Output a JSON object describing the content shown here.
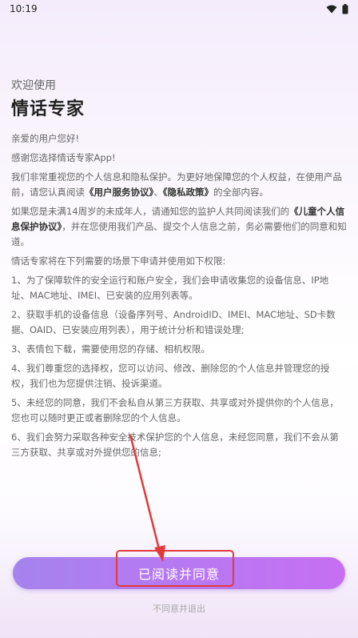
{
  "status_bar": {
    "time": "10:19"
  },
  "header": {
    "welcome": "欢迎使用",
    "title": "情话专家"
  },
  "content": {
    "greeting": "亲爱的用户您好!",
    "thanks": "感谢您选择情话专家App!",
    "p1_a": "我们非常重视您的个人信息和隐私保护。为更好地保障您的个人权益，在使用产品前，请您认真阅读",
    "p1_link1": "《用户服务协议》",
    "p1_b": "、",
    "p1_link2": "《隐私政策》",
    "p1_c": "的全部内容。",
    "p2_a": "如果您是未满14周岁的未成年人，请通知您的监护人共同阅读我们的",
    "p2_link": "《儿童个人信息保护协议》",
    "p2_b": "，并在您使用我们产品、提交个人信息之前，务必需要他们的同意和知道。",
    "p3": "情话专家将在下列需要的场景下申请并使用如下权限:",
    "items": [
      "1、为了保障软件的安全运行和账户安全，我们会申请收集您的设备信息、IP地址、MAC地址、IMEI、已安装的应用列表等。",
      "2、获取手机的设备信息（设备序列号、AndroidID、IMEI、MAC地址、SD卡数据、OAID、已安装应用列表），用于统计分析和错误处理;",
      "3、表情包下载，需要使用您的存储、相机权限。",
      "4、我们尊重您的选择权，您可以访问、修改、删除您的个人信息并管理您的授权，我们也为您提供注销、投诉渠道。",
      "5、未经您的同意，我们不会私自从第三方获取、共享或对外提供你的个人信息，您也可以随时更正或者删除您的个人信息。",
      "6、我们会努力采取各种安全技术保护您的个人信息，未经您同意，我们不会从第三方获取、共享或对外提供您的信息;"
    ]
  },
  "actions": {
    "agree_label": "已阅读并同意",
    "decline_label": "不同意并退出"
  },
  "colors": {
    "accent": "#b57af1",
    "annotation": "#e03a3a"
  },
  "icons": {
    "wifi": "wifi-icon",
    "battery": "battery-icon"
  }
}
